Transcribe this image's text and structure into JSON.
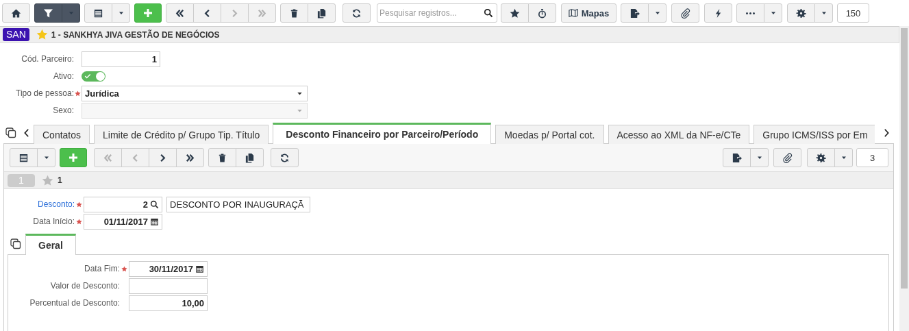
{
  "toolbar": {
    "filter_active": true,
    "navigation": [
      {
        "disabled": false
      },
      {
        "disabled": false
      },
      {
        "disabled": true
      },
      {
        "disabled": true
      }
    ],
    "search": {
      "placeholder": "Pesquisar registros..."
    },
    "maps_button": "Mapas",
    "page_size": "150"
  },
  "header": {
    "badge": "SAN",
    "favorite": true,
    "title": "1 - SANKHYA JIVA GESTÃO DE NEGÓCIOS"
  },
  "form": {
    "fields": [
      {
        "label": "Cód. Parceiro:",
        "kind": "text",
        "required": false,
        "disabled": false,
        "value": "1"
      },
      {
        "label": "Ativo:",
        "kind": "toggle",
        "required": false,
        "disabled": false,
        "on": true
      },
      {
        "label": "Tipo de pessoa:",
        "kind": "select",
        "required": true,
        "disabled": false,
        "value": "Jurídica"
      },
      {
        "label": "Sexo:",
        "kind": "select",
        "required": false,
        "disabled": true
      }
    ]
  },
  "tabs": [
    {
      "label": "Contatos",
      "selected": false
    },
    {
      "label": "Limite de Crédito p/ Grupo Tip. Título",
      "selected": false
    },
    {
      "label": "Desconto Financeiro por Parceiro/Período",
      "selected": true
    },
    {
      "label": "Moedas p/ Portal cot.",
      "selected": false
    },
    {
      "label": "Acesso ao XML da NF-e/CTe",
      "selected": false
    },
    {
      "label": "Grupo ICMS/ISS por Em",
      "selected": false
    }
  ],
  "detail": {
    "toolbar": {
      "navigation": [
        {
          "disabled": true
        },
        {
          "disabled": true
        },
        {
          "disabled": false
        },
        {
          "disabled": false
        }
      ],
      "page_size": "3"
    },
    "record_bar": {
      "record_number": "1",
      "favorite": false,
      "label": "1"
    },
    "form": {
      "fields": [
        {
          "label": "Desconto:",
          "kind": "lookup",
          "linked": true,
          "required": true,
          "value": "2",
          "description": "DESCONTO POR INAUGURAÇÃ"
        },
        {
          "label": "Data Início:",
          "kind": "date",
          "linked": false,
          "required": true,
          "value": "01/11/2017"
        }
      ]
    },
    "tabs": [
      {
        "label": "Geral",
        "selected": true
      }
    ],
    "general": {
      "fields": [
        {
          "label": "Data Fim:",
          "kind": "date",
          "required": true,
          "value": "30/11/2017"
        },
        {
          "label": "Valor de Desconto:",
          "kind": "text",
          "required": false
        },
        {
          "label": "Percentual de Desconto:",
          "kind": "text",
          "required": false,
          "value": "10,00"
        }
      ]
    }
  }
}
